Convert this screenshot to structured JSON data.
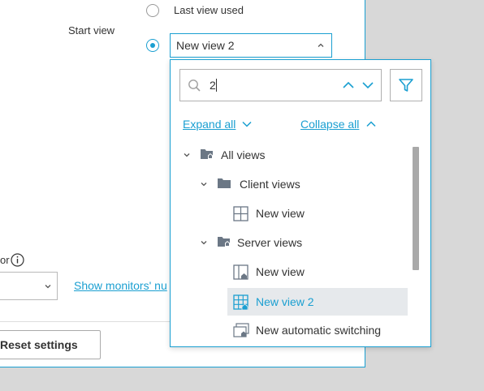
{
  "start_view": {
    "label": "Start view",
    "option_last_view": "Last view used",
    "selected_value": "New view 2"
  },
  "left_fragment": {
    "label_suffix": "or",
    "link": "Show monitors' nu",
    "reset_button": "Reset settings"
  },
  "dropdown": {
    "search_value": "2",
    "expand_all": "Expand all",
    "collapse_all": "Collapse all",
    "tree": [
      {
        "label": "All views",
        "icon": "folder-home-icon",
        "expanded": true
      },
      {
        "label": "Client views",
        "icon": "folder-icon",
        "expanded": true
      },
      {
        "label": "New view",
        "icon": "grid-icon"
      },
      {
        "label": "Server views",
        "icon": "folder-home-icon",
        "expanded": true
      },
      {
        "label": "New view",
        "icon": "layout-home-icon"
      },
      {
        "label": "New view 2",
        "icon": "grid-home-icon",
        "selected": true
      },
      {
        "label": "New automatic switching",
        "icon": "switching-icon"
      }
    ]
  },
  "colors": {
    "accent": "#1a9fd1",
    "selected_bg": "#e6e9ec",
    "icon_gray": "#6b7785"
  }
}
